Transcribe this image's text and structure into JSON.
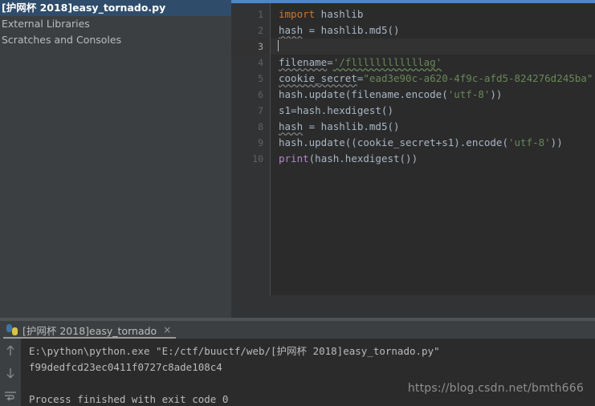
{
  "project_panel": {
    "items": [
      {
        "label": "[护网杯 2018]easy_tornado.py",
        "selected": true
      },
      {
        "label": "External Libraries",
        "selected": false
      },
      {
        "label": "Scratches and Consoles",
        "selected": false
      }
    ]
  },
  "editor": {
    "current_line": 3,
    "gutter_numbers": [
      "1",
      "2",
      "3",
      "4",
      "5",
      "6",
      "7",
      "8",
      "9",
      "10"
    ],
    "lines": [
      {
        "n": "1",
        "text": "import hashlib"
      },
      {
        "n": "2",
        "text": "hash = hashlib.md5()"
      },
      {
        "n": "3",
        "text": ""
      },
      {
        "n": "4",
        "text": "filename='/fllllllllllllag'"
      },
      {
        "n": "5",
        "text": "cookie_secret=\"ead3e90c-a620-4f9c-afd5-824276d245ba\""
      },
      {
        "n": "6",
        "text": "hash.update(filename.encode('utf-8'))"
      },
      {
        "n": "7",
        "text": "s1=hash.hexdigest()"
      },
      {
        "n": "8",
        "text": "hash = hashlib.md5()"
      },
      {
        "n": "9",
        "text": "hash.update((cookie_secret+s1).encode('utf-8'))"
      },
      {
        "n": "10",
        "text": "print(hash.hexdigest())"
      }
    ],
    "tokens": {
      "kw_import": "import",
      "id_hashlib": " hashlib",
      "id_hash": "hash",
      "eq_hashlib_md5": " = hashlib.md5()",
      "id_filename": "filename",
      "eq": "=",
      "str_filename": "'/fllllllllllllag'",
      "id_cookie_secret": "cookie_secret",
      "str_cookie_secret": "\"ead3e90c-a620-4f9c-afd5-824276d245ba\"",
      "l6_a": "hash.update(filename.encode(",
      "l6_str": "'utf-8'",
      "l6_b": "))",
      "l7": "s1=hash.hexdigest()",
      "l9_a": "hash.update((cookie_secret+s1).encode(",
      "l9_str": "'utf-8'",
      "l9_b": "))",
      "l10_fn": "print",
      "l10_rest": "(hash.hexdigest())"
    }
  },
  "run_window": {
    "tab_label": "[护网杯 2018]easy_tornado",
    "tab_close_glyph": "×",
    "python_icon": "python-logo",
    "toolbar": {
      "up_glyph": "↑",
      "down_glyph": "↓",
      "wrap_glyph": "↵"
    },
    "console_lines": [
      "E:\\python\\python.exe \"E:/ctf/buuctf/web/[护网杯 2018]easy_tornado.py\"",
      "f99dedfcd23ec0411f0727c8ade108c4",
      "",
      "Process finished with exit code 0"
    ]
  },
  "watermark": {
    "text": "https://blog.csdn.net/bmth666"
  },
  "colors": {
    "panel_bg": "#3c3f41",
    "editor_bg": "#2b2b2b",
    "gutter_bg": "#313335",
    "selection_blue": "#2f4d6b",
    "tab_underline": "#4a88c7",
    "keyword": "#cc7832",
    "string": "#6a8759",
    "function": "#b389c5",
    "text": "#a9b7c6",
    "console_text": "#bbbbbb",
    "current_line": "#323232",
    "watermark": "#8f8f8f"
  }
}
